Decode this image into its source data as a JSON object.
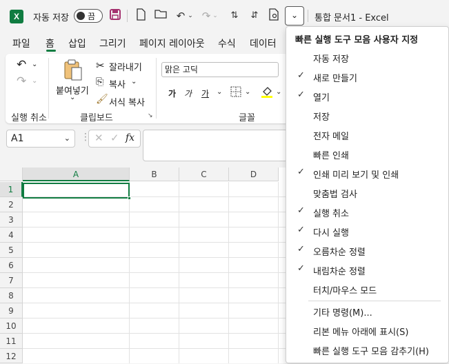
{
  "titlebar": {
    "logo": "X",
    "autosave_label": "자동 저장",
    "autosave_state": "끔",
    "doc_title": "통합 문서1  -  Excel"
  },
  "tabs": [
    "파일",
    "홈",
    "삽입",
    "그리기",
    "페이지 레이아웃",
    "수식",
    "데이터"
  ],
  "ribbon": {
    "paste_label": "붙여넣기",
    "cut_label": "잘라내기",
    "copy_label": "복사",
    "format_painter_label": "서식 복사",
    "font_name": "맑은 고딕",
    "bold": "가",
    "italic": "가",
    "underline": "가",
    "groups": {
      "undo": "실행 취소",
      "clipboard": "클립보드",
      "font": "글꼴"
    }
  },
  "formula_bar": {
    "name_box": "A1",
    "fx": "fx"
  },
  "grid": {
    "columns": [
      "A",
      "B",
      "C",
      "D"
    ],
    "rows": [
      "1",
      "2",
      "3",
      "4",
      "5",
      "6",
      "7",
      "8",
      "9",
      "10",
      "11",
      "12"
    ]
  },
  "qat_menu": {
    "header": "빠른 실행 도구 모음 사용자 지정",
    "items": [
      {
        "label": "자동 저장",
        "checked": ""
      },
      {
        "label": "새로 만들기",
        "checked": "✓"
      },
      {
        "label": "열기",
        "checked": "✓"
      },
      {
        "label": "저장",
        "checked": ""
      },
      {
        "label": "전자 메일",
        "checked": ""
      },
      {
        "label": "빠른 인쇄",
        "checked": ""
      },
      {
        "label": "인쇄 미리 보기 및 인쇄",
        "checked": "✓"
      },
      {
        "label": "맞춤법 검사",
        "checked": ""
      },
      {
        "label": "실행 취소",
        "checked": "✓"
      },
      {
        "label": "다시 실행",
        "checked": "✓"
      },
      {
        "label": "오름차순 정렬",
        "checked": "✓"
      },
      {
        "label": "내림차순 정렬",
        "checked": "✓"
      },
      {
        "label": "터치/마우스 모드",
        "checked": ""
      }
    ],
    "extra_items": [
      {
        "label": "기타 명령(M)..."
      },
      {
        "label": "리본 메뉴 아래에 표시(S)"
      },
      {
        "label": "빠른 실행 도구 모음 감추기(H)"
      }
    ]
  },
  "colors": {
    "accent": "#107c41"
  }
}
